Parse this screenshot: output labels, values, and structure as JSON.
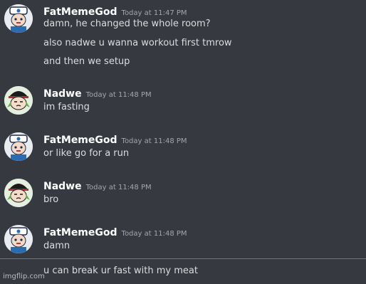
{
  "messages": [
    {
      "username": "FatMemeGod",
      "timestamp": "Today at 11:47 PM",
      "lines": [
        "damn, he changed the whole room?",
        "also nadwe u wanna workout first tmrow",
        "and then we setup"
      ]
    },
    {
      "username": "Nadwe",
      "timestamp": "Today at 11:48 PM",
      "lines": [
        "im fasting"
      ]
    },
    {
      "username": "FatMemeGod",
      "timestamp": "Today at 11:48 PM",
      "lines": [
        "or like go for a run"
      ]
    },
    {
      "username": "Nadwe",
      "timestamp": "Today at 11:48 PM",
      "lines": [
        "bro"
      ]
    },
    {
      "username": "FatMemeGod",
      "timestamp": "Today at 11:48 PM",
      "lines": [
        "damn",
        "u can break ur fast with my meat"
      ]
    }
  ],
  "watermark": "imgflip.com",
  "colors": {
    "background": "#36393f",
    "username": "#ffffff",
    "text": "#dcddde",
    "timestamp": "#a3a6aa",
    "new_messages_divider": "#ed4245"
  }
}
